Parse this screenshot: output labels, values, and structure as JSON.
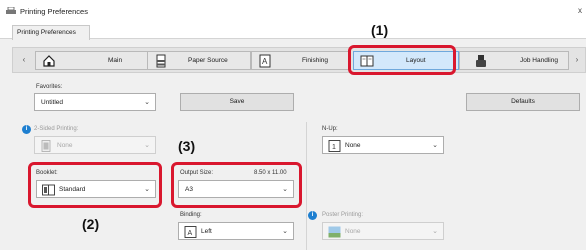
{
  "window": {
    "title": "Printing Preferences",
    "close_glyph": "x",
    "tab_label": "Printing Preferences"
  },
  "nav": {
    "left_arrow": "‹",
    "right_arrow": "›",
    "items": [
      {
        "label": "Main",
        "icon": "home-icon"
      },
      {
        "label": "Paper Source",
        "icon": "paper-tray-icon"
      },
      {
        "label": "Finishing",
        "icon": "finishing-icon"
      },
      {
        "label": "Layout",
        "icon": "layout-icon",
        "selected": true
      },
      {
        "label": "Job Handling",
        "icon": "job-handling-icon"
      }
    ]
  },
  "favorites": {
    "label": "Favorites:",
    "value": "Untitled",
    "save_label": "Save",
    "defaults_label": "Defaults"
  },
  "two_sided": {
    "label": "2-Sided Printing:",
    "value": "None"
  },
  "booklet": {
    "label": "Booklet:",
    "value": "Standard"
  },
  "output_size": {
    "label": "Output Size:",
    "dimensions": "8.50 x 11.00",
    "value": "A3"
  },
  "binding": {
    "label": "Binding:",
    "value": "Left"
  },
  "n_up": {
    "label": "N-Up:",
    "value": "None"
  },
  "poster": {
    "label": "Poster Printing:",
    "value": "None"
  },
  "callouts": {
    "c1": "(1)",
    "c2": "(2)",
    "c3": "(3)"
  },
  "colors": {
    "highlight": "#d9172e",
    "info_blue": "#1e7fd0",
    "selected_tab": "#d3e8fb"
  }
}
